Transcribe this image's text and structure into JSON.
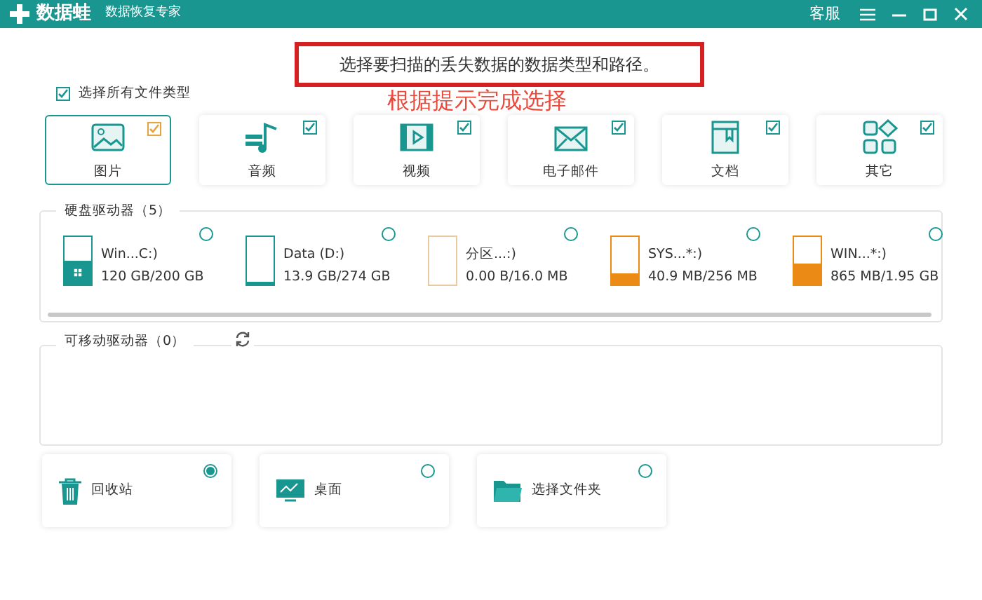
{
  "title_bar": {
    "app_name": "数据蛙",
    "subtitle": "数据恢复专家",
    "support": "客服"
  },
  "instruction": "选择要扫描的丢失数据的数据类型和路径。",
  "annotation": "根据提示完成选择",
  "select_all": {
    "label": "选择所有文件类型",
    "checked": true
  },
  "file_types": [
    {
      "kind": "image",
      "label": "图片",
      "selected": true,
      "checked": true
    },
    {
      "kind": "audio",
      "label": "音频",
      "selected": false,
      "checked": true
    },
    {
      "kind": "video",
      "label": "视频",
      "selected": false,
      "checked": true
    },
    {
      "kind": "mail",
      "label": "电子邮件",
      "selected": false,
      "checked": true
    },
    {
      "kind": "document",
      "label": "文档",
      "selected": false,
      "checked": true
    },
    {
      "kind": "other",
      "label": "其它",
      "selected": false,
      "checked": true
    }
  ],
  "hard_drives": {
    "title": "硬盘驱动器（5）",
    "items": [
      {
        "name": "Win...C:)",
        "size": "120 GB/200 GB",
        "level": 0.5,
        "color": "#1a9690",
        "system": true,
        "selected": false
      },
      {
        "name": "Data (D:)",
        "size": "13.9 GB/274 GB",
        "level": 0.05,
        "color": "#1a9690",
        "system": false,
        "selected": false
      },
      {
        "name": "分区...:)",
        "size": "0.00  B/16.0 MB",
        "level": 0,
        "color": "#e8c9a0",
        "system": false,
        "selected": false
      },
      {
        "name": "SYS...*:)",
        "size": "40.9 MB/256 MB",
        "level": 0.25,
        "color": "#ec8a16",
        "system": false,
        "selected": false
      },
      {
        "name": "WIN...*:)",
        "size": "865 MB/1.95 GB",
        "level": 0.45,
        "color": "#ec8a16",
        "system": false,
        "selected": false
      }
    ]
  },
  "removable_drives": {
    "title": "可移动驱动器（0）"
  },
  "locations": [
    {
      "kind": "trash",
      "label": "回收站",
      "selected": true
    },
    {
      "kind": "desktop",
      "label": "桌面",
      "selected": false
    },
    {
      "kind": "folder",
      "label": "选择文件夹",
      "selected": false
    }
  ]
}
